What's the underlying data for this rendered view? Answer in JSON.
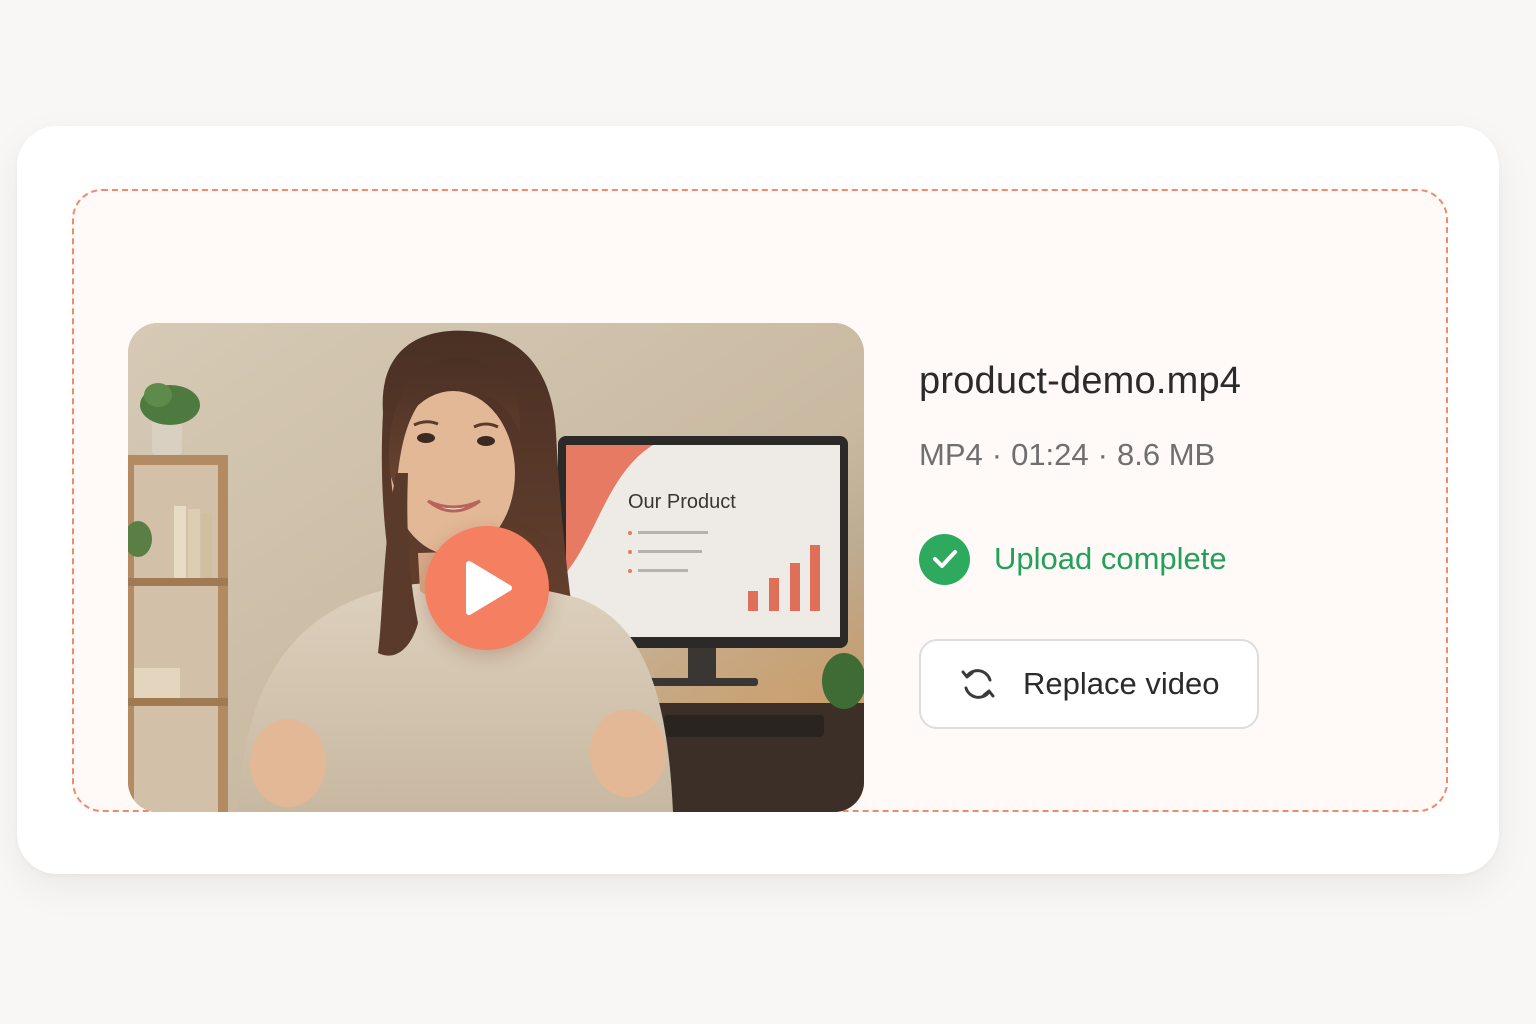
{
  "file": {
    "name": "product-demo.mp4",
    "format": "MP4",
    "duration": "01:24",
    "size": "8.6 MB",
    "separator": "·"
  },
  "status": {
    "text": "Upload complete",
    "icon": "check-circle-icon",
    "color": "#2eaa5f"
  },
  "actions": {
    "replace_label": "Replace video",
    "replace_icon": "refresh-icon"
  },
  "video": {
    "screen_title": "Our Product",
    "play_icon": "play-icon",
    "accent": "#f47f61"
  },
  "colors": {
    "dropzone_border": "#f08a6c",
    "background": "#f8f7f5"
  }
}
